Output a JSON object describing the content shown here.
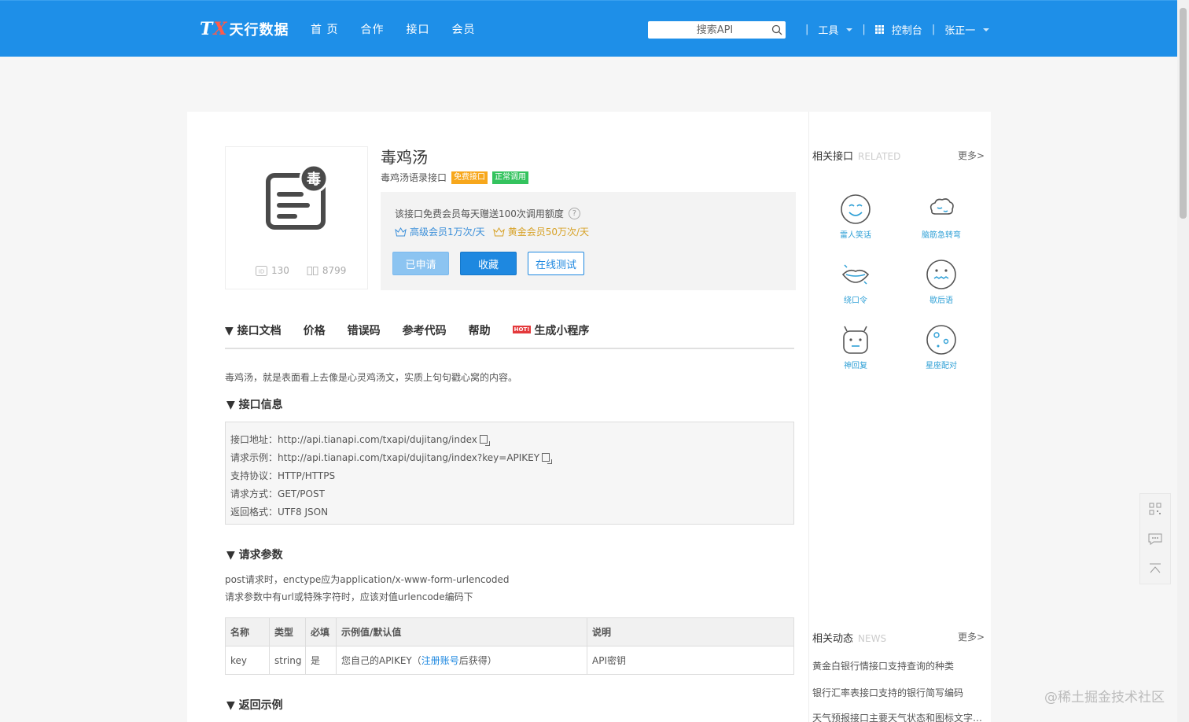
{
  "header": {
    "logo_mark": "TX",
    "logo_text": "天行数据",
    "nav": [
      "首 页",
      "合作",
      "接口",
      "会员"
    ],
    "search_placeholder": "搜索API",
    "tools_label": "工具",
    "console_label": "控制台",
    "user_label": "张正一",
    "sep": "|"
  },
  "api": {
    "title": "毒鸡汤",
    "subtitle": "毒鸡汤语录接口",
    "badge_free": "免费接口",
    "badge_status": "正常调用",
    "icon_char": "毒",
    "id_value": "130",
    "views_value": "8799",
    "quota_text": "该接口免费会员每天赠送100次调用额度",
    "quota_help": "?",
    "tier_senior": "高级会员1万次/天",
    "tier_gold": "黄金会员50万次/天",
    "btn_applied": "已申请",
    "btn_fav": "收藏",
    "btn_test": "在线测试",
    "colors": {
      "free_badge": "#f7a71c",
      "status_badge": "#34c35e",
      "primary": "#1e88e0"
    }
  },
  "tabs": [
    {
      "label": "▼ 接口文档"
    },
    {
      "label": "价格"
    },
    {
      "label": "错误码"
    },
    {
      "label": "参考代码"
    },
    {
      "label": "帮助"
    },
    {
      "label": "生成小程序",
      "hot": "HOT!"
    }
  ],
  "doc": {
    "description": "毒鸡汤，就是表面看上去像是心灵鸡汤文，实质上句句戳心窝的内容。",
    "sec_info": "▼ 接口信息",
    "info": [
      {
        "k": "接口地址：",
        "v": "http://api.tianapi.com/txapi/dujitang/index",
        "copy": true
      },
      {
        "k": "请求示例：",
        "v": "http://api.tianapi.com/txapi/dujitang/index?key=APIKEY",
        "copy": true
      },
      {
        "k": "支持协议：",
        "v": "HTTP/HTTPS",
        "copy": false
      },
      {
        "k": "请求方式：",
        "v": "GET/POST",
        "copy": false
      },
      {
        "k": "返回格式：",
        "v": "UTF8 JSON",
        "copy": false
      }
    ],
    "sec_params": "▼ 请求参数",
    "note1": "post请求时，enctype应为application/x-www-form-urlencoded",
    "note2": "请求参数中有url或特殊字符时，应该对值urlencode编码下",
    "table_headers": [
      "名称",
      "类型",
      "必填",
      "示例值/默认值",
      "说明"
    ],
    "table_row": {
      "name": "key",
      "type": "string",
      "required": "是",
      "example_pre": "您自己的APIKEY（",
      "example_link": "注册账号",
      "example_post": "后获得）",
      "desc": "API密钥"
    },
    "sec_return": "▼ 返回示例"
  },
  "sidebar": {
    "related_title": "相关接口",
    "related_en": "RELATED",
    "more": "更多>",
    "related": [
      {
        "label": "雷人笑话",
        "icon": "laughing-face-icon"
      },
      {
        "label": "脑筋急转弯",
        "icon": "brain-icon"
      },
      {
        "label": "绕口令",
        "icon": "lips-icon"
      },
      {
        "label": "歇后语",
        "icon": "zipper-face-icon"
      },
      {
        "label": "神回复",
        "icon": "robot-face-icon"
      },
      {
        "label": "星座配对",
        "icon": "constellation-icon"
      }
    ],
    "news_title": "相关动态",
    "news_en": "NEWS",
    "news": [
      "黄金白银行情接口支持查询的种类",
      "银行汇率表接口支持的银行简写编码",
      "天气预报接口主要天气状态和图标文字说明"
    ]
  },
  "watermark": "@稀土掘金技术社区"
}
